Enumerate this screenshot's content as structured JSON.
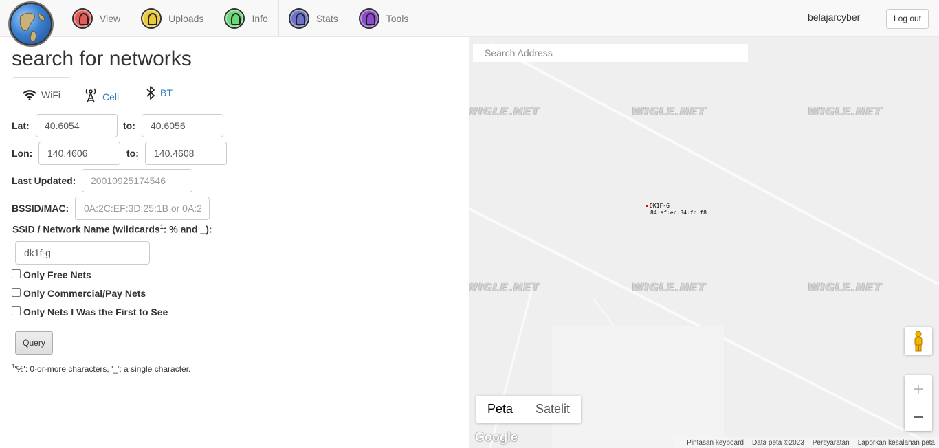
{
  "nav": {
    "items": [
      {
        "label": "View",
        "color": "#e45b5b"
      },
      {
        "label": "Uploads",
        "color": "#e8c93a"
      },
      {
        "label": "Info",
        "color": "#6bd67a"
      },
      {
        "label": "Stats",
        "color": "#6c73c8"
      },
      {
        "label": "Tools",
        "color": "#8a4bc9"
      }
    ],
    "username": "belajarcyber",
    "logout_label": "Log out"
  },
  "search": {
    "title": "search for networks",
    "tabs": [
      {
        "label": "WiFi",
        "icon": "wifi-icon",
        "active": true
      },
      {
        "label": "Cell",
        "icon": "cell-tower-icon",
        "active": false
      },
      {
        "label": "BT",
        "icon": "bluetooth-icon",
        "active": false
      }
    ],
    "lat_label": "Lat:",
    "lat_from": "40.6054",
    "lat_to": "40.6056",
    "lon_label": "Lon:",
    "lon_from": "140.4606",
    "lon_to": "140.4608",
    "to_label": "to:",
    "last_updated_label": "Last Updated:",
    "last_updated_placeholder": "20010925174546",
    "bssid_label": "BSSID/MAC:",
    "bssid_placeholder": "0A:2C:EF:3D:25:1B or 0A:2",
    "ssid_label_pre": "SSID / Network Name (wildcards",
    "ssid_label_sup": "1",
    "ssid_label_post": ": % and _):",
    "ssid_value": "dk1f-g",
    "checkboxes": [
      {
        "label": "Only Free Nets",
        "checked": false
      },
      {
        "label": "Only Commercial/Pay Nets",
        "checked": false
      },
      {
        "label": "Only Nets I Was the First to See",
        "checked": false
      }
    ],
    "query_label": "Query",
    "footnote_sup": "1",
    "footnote_text": "'%': 0-or-more characters, '_': a single character."
  },
  "map": {
    "search_placeholder": "Search Address",
    "watermark": "WIGLE.NET",
    "pin_ssid": "DK1F-G",
    "pin_bssid": "84:af:ec:34:fc:f8",
    "map_type_map": "Peta",
    "map_type_satellite": "Satelit",
    "zoom_in": "+",
    "zoom_out": "−",
    "google_logo": "Google",
    "attribution": [
      "Pintasan keyboard",
      "Data peta ©2023",
      "Persyaratan",
      "Laporkan kesalahan peta"
    ]
  }
}
